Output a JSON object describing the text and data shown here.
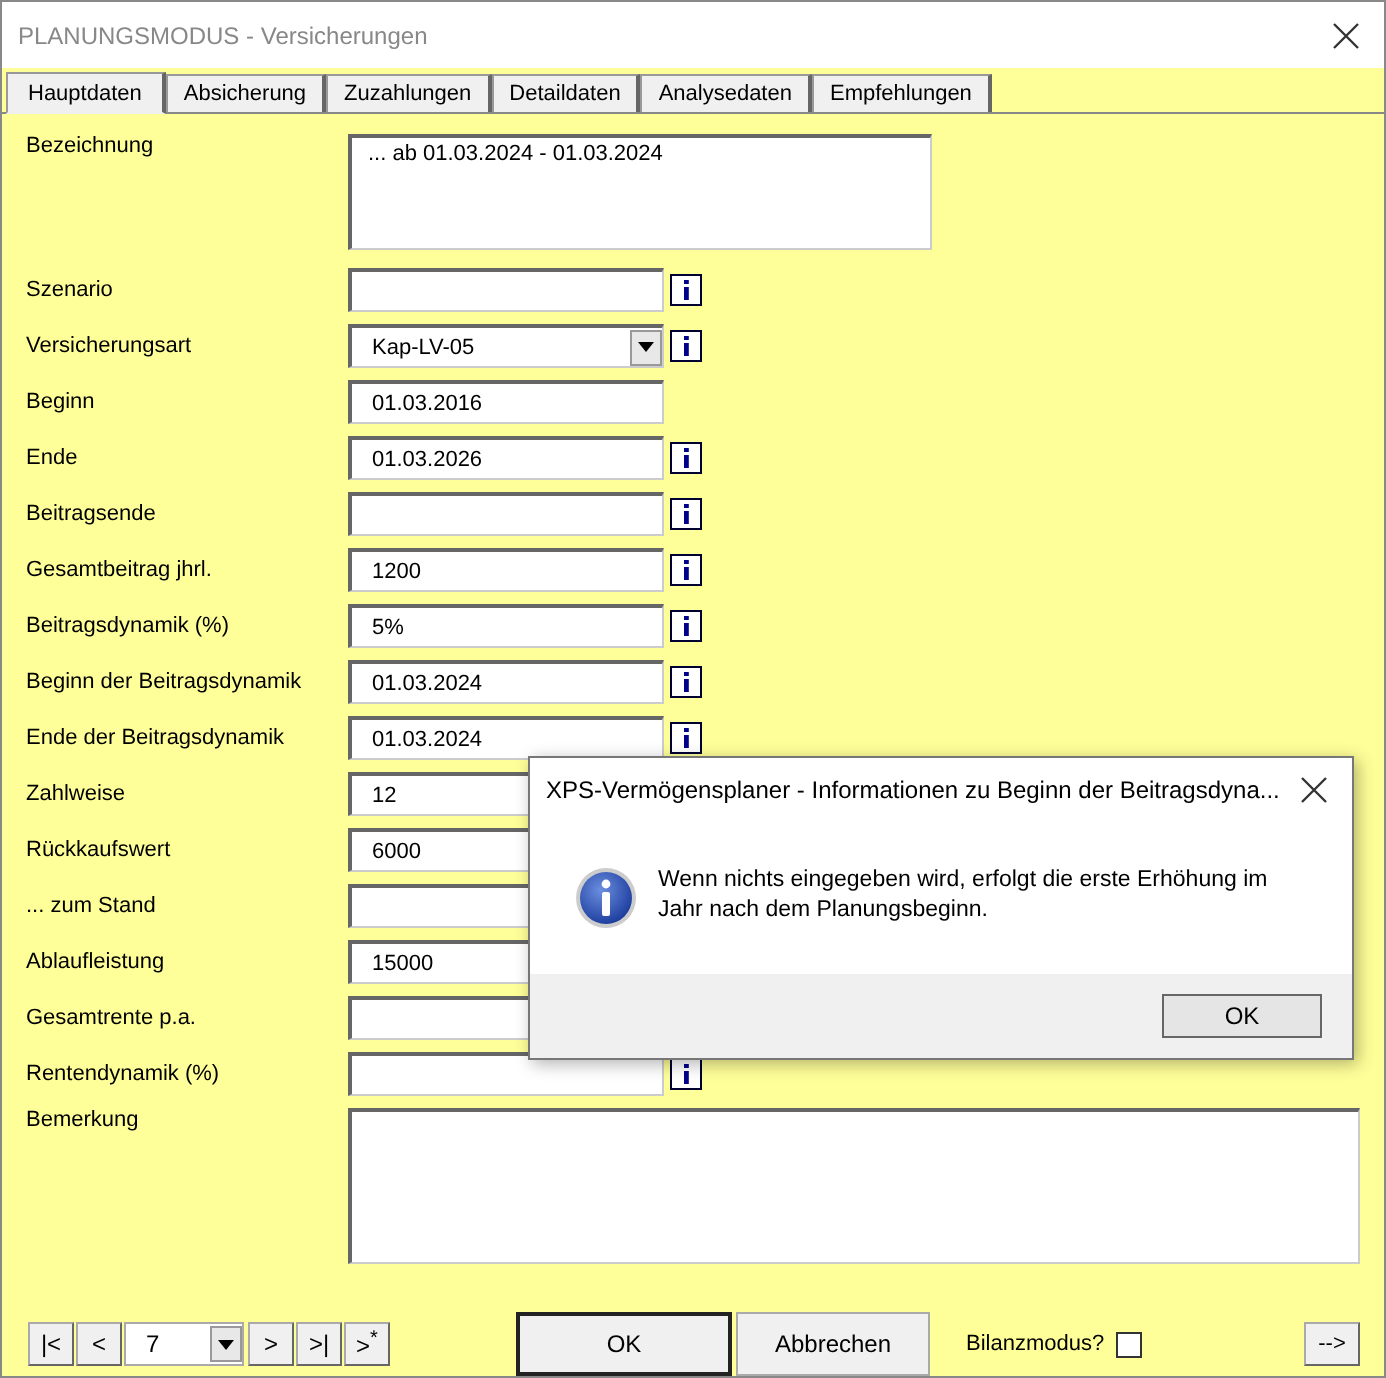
{
  "window": {
    "title": "PLANUNGSMODUS - Versicherungen"
  },
  "tabs": [
    {
      "label": "Hauptdaten",
      "selected": true
    },
    {
      "label": "Absicherung",
      "selected": false
    },
    {
      "label": "Zuzahlungen",
      "selected": false
    },
    {
      "label": "Detaildaten",
      "selected": false
    },
    {
      "label": "Analysedaten",
      "selected": false
    },
    {
      "label": "Empfehlungen",
      "selected": false
    }
  ],
  "description": {
    "label": "Bezeichnung",
    "value": "... ab 01.03.2024 - 01.03.2024"
  },
  "rows": [
    {
      "label": "Szenario",
      "kind": "text",
      "info": true
    },
    {
      "label": "Versicherungsart",
      "value": "Kap-LV-05",
      "kind": "combo",
      "info": true
    },
    {
      "label": "Beginn",
      "value": "01.03.2016",
      "kind": "text",
      "info": false
    },
    {
      "label": "Ende",
      "value": "01.03.2026",
      "kind": "text",
      "info": true
    },
    {
      "label": "Beitragsende",
      "kind": "text",
      "info": true
    },
    {
      "label": "Gesamtbeitrag jhrl.",
      "value": "1200",
      "kind": "text",
      "info": true
    },
    {
      "label": "Beitragsdynamik (%)",
      "value": "5%",
      "kind": "text",
      "info": true
    },
    {
      "label": "Beginn der Beitragsdynamik",
      "value": "01.03.2024",
      "kind": "text",
      "info": true
    },
    {
      "label": "Ende der Beitragsdynamik",
      "value": "01.03.2024",
      "kind": "text",
      "info": true
    },
    {
      "label": "Zahlweise",
      "value": "12",
      "kind": "text"
    },
    {
      "label": "Rückkaufswert",
      "value": "6000",
      "kind": "text"
    },
    {
      "label": "... zum Stand",
      "kind": "text"
    },
    {
      "label": "Ablaufleistung",
      "value": "15000",
      "kind": "text"
    },
    {
      "label": "Gesamtrente p.a.",
      "kind": "text"
    },
    {
      "label": "Rentendynamik (%)",
      "kind": "text",
      "info": true
    }
  ],
  "remark": {
    "label": "Bemerkung"
  },
  "navigation": {
    "first": "|<",
    "previous": "<",
    "record": "7",
    "next": ">",
    "last": ">|",
    "new": ">$^{*}$"
  },
  "buttons": {
    "ok": "OK",
    "cancel": "Abbrechen",
    "forward": "-->"
  },
  "balance_mode": {
    "label": "Bilanzmodus?",
    "checked": false
  },
  "dialog": {
    "title": "XPS-Vermögensplaner  -  Informationen zu Beginn der Beitragsdyna...",
    "message": "Wenn nichts eingegeben wird, erfolgt die erste Erhöhung im Jahr nach dem Planungsbeginn.",
    "ok": "OK"
  }
}
